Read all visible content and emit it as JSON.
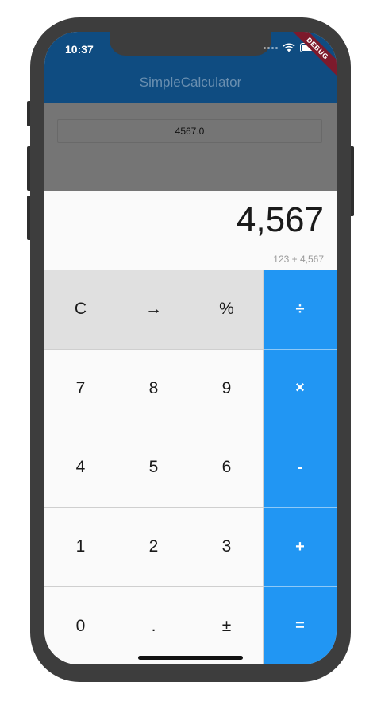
{
  "status_bar": {
    "time": "10:37"
  },
  "debug_banner": "DEBUG",
  "app_bar": {
    "title": "SimpleCalculator"
  },
  "result_field": {
    "value": "4567.0"
  },
  "display": {
    "value": "4,567",
    "expression": "123 + 4,567"
  },
  "keys": [
    {
      "label": "C",
      "style": "gray"
    },
    {
      "label": "→",
      "style": "gray"
    },
    {
      "label": "%",
      "style": "gray"
    },
    {
      "label": "÷",
      "style": "op"
    },
    {
      "label": "7",
      "style": "num"
    },
    {
      "label": "8",
      "style": "num"
    },
    {
      "label": "9",
      "style": "num"
    },
    {
      "label": "×",
      "style": "op"
    },
    {
      "label": "4",
      "style": "num"
    },
    {
      "label": "5",
      "style": "num"
    },
    {
      "label": "6",
      "style": "num"
    },
    {
      "label": "-",
      "style": "op"
    },
    {
      "label": "1",
      "style": "num"
    },
    {
      "label": "2",
      "style": "num"
    },
    {
      "label": "3",
      "style": "num"
    },
    {
      "label": "+",
      "style": "op"
    },
    {
      "label": "0",
      "style": "num"
    },
    {
      "label": ".",
      "style": "num"
    },
    {
      "label": "±",
      "style": "num"
    },
    {
      "label": "=",
      "style": "op"
    }
  ],
  "colors": {
    "app_bar": "#0f4c81",
    "operator_key": "#2196f3",
    "function_key": "#e0e0e0",
    "result_panel": "#757575",
    "debug_banner": "#7d1a2c"
  },
  "icons": {
    "signal": "cellular-signal-icon",
    "wifi": "wifi-icon",
    "battery": "battery-icon"
  }
}
